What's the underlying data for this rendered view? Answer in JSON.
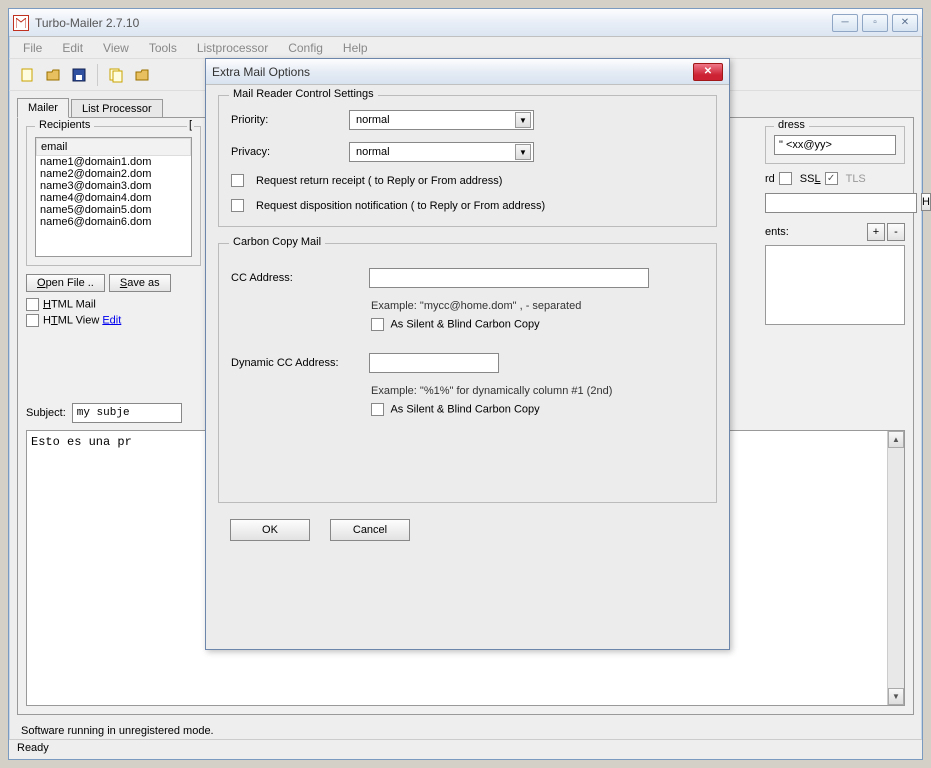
{
  "window": {
    "title": "Turbo-Mailer 2.7.10"
  },
  "menus": [
    "File",
    "Edit",
    "View",
    "Tools",
    "Listprocessor",
    "Config",
    "Help"
  ],
  "tabs": {
    "mailer": "Mailer",
    "listproc": "List Processor"
  },
  "main": {
    "recipients_label": "Recipients",
    "email_header": "email",
    "emails": [
      "name1@domain1.dom",
      "name2@domain2.dom",
      "name3@domain3.dom",
      "name4@domain4.dom",
      "name5@domain5.dom",
      "name6@domain6.dom"
    ],
    "open_file_btn": "Open File ..",
    "save_as_btn": "Save as",
    "html_mail": "HTML Mail",
    "html_view": "HTML View",
    "edit_link": "Edit",
    "subject_label": "Subject:",
    "subject_value": "my subje",
    "body_text": "Esto es una pr",
    "sender_partial_label": "dress",
    "sender_hint": "\" <xx@yy>",
    "rd_label": "rd",
    "ssl_label": "SSL",
    "tls_label": "TLS",
    "h_btn": "H",
    "ents_label": "ents:",
    "plus": "+",
    "minus": "-"
  },
  "dialog": {
    "title": "Extra Mail Options",
    "group1_title": "Mail Reader Control Settings",
    "priority_label": "Priority:",
    "priority_value": "normal",
    "privacy_label": "Privacy:",
    "privacy_value": "normal",
    "return_receipt": "Request return receipt  ( to Reply or From address)",
    "disposition": "Request disposition notification  ( to Reply or From address)",
    "group2_title": "Carbon Copy Mail",
    "cc_label": "CC Address:",
    "cc_example": "Example: \"mycc@home.dom\"    , - separated",
    "cc_blind": "As Silent & Blind Carbon Copy",
    "dyncc_label": "Dynamic CC Address:",
    "dyncc_example": "Example: \"%1%\" for dynamically column #1 (2nd)",
    "dyncc_blind": "As Silent & Blind Carbon Copy",
    "ok": "OK",
    "cancel": "Cancel"
  },
  "footer": {
    "unregistered": "Software running in unregistered mode.",
    "status": "Ready"
  }
}
